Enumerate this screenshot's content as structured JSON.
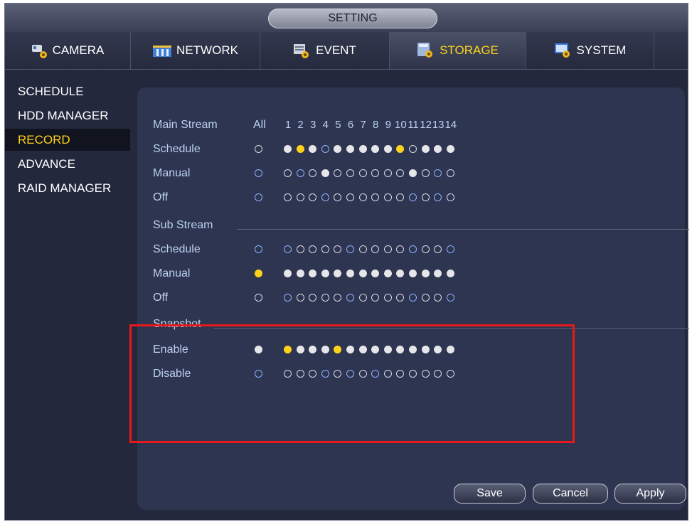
{
  "window": {
    "title": "SETTING"
  },
  "tabs": [
    {
      "label": "CAMERA",
      "icon": "camera-icon",
      "active": false
    },
    {
      "label": "NETWORK",
      "icon": "network-icon",
      "active": false
    },
    {
      "label": "EVENT",
      "icon": "event-icon",
      "active": false
    },
    {
      "label": "STORAGE",
      "icon": "storage-icon",
      "active": true
    },
    {
      "label": "SYSTEM",
      "icon": "system-icon",
      "active": false
    }
  ],
  "sidebar": {
    "items": [
      {
        "label": "SCHEDULE",
        "active": false
      },
      {
        "label": "HDD MANAGER",
        "active": false
      },
      {
        "label": "RECORD",
        "active": true
      },
      {
        "label": "ADVANCE",
        "active": false
      },
      {
        "label": "RAID MANAGER",
        "active": false
      }
    ]
  },
  "record": {
    "main_stream_label": "Main Stream",
    "all_label": "All",
    "channels": [
      "1",
      "2",
      "3",
      "4",
      "5",
      "6",
      "7",
      "8",
      "9",
      "10",
      "11",
      "12",
      "13",
      "14"
    ],
    "sections": [
      {
        "title": "",
        "rows": [
          {
            "label": "Schedule",
            "all": "off",
            "states": [
              "on",
              "sel",
              "on",
              "offb",
              "on",
              "on",
              "on",
              "on",
              "on",
              "sel",
              "off",
              "on",
              "on",
              "on"
            ]
          },
          {
            "label": "Manual",
            "all": "offb",
            "states": [
              "off",
              "offb",
              "off",
              "on",
              "off",
              "off",
              "off",
              "off",
              "off",
              "off",
              "on",
              "off",
              "offb",
              "off"
            ]
          },
          {
            "label": "Off",
            "all": "offb",
            "states": [
              "off",
              "off",
              "off",
              "offb",
              "off",
              "off",
              "off",
              "off",
              "off",
              "off",
              "offb",
              "off",
              "offb",
              "off"
            ]
          }
        ]
      },
      {
        "title": "Sub Stream",
        "rows": [
          {
            "label": "Schedule",
            "all": "offb",
            "states": [
              "offb",
              "off",
              "off",
              "off",
              "off",
              "offb",
              "off",
              "off",
              "off",
              "off",
              "offb",
              "off",
              "off",
              "offb"
            ]
          },
          {
            "label": "Manual",
            "all": "sel",
            "states": [
              "on",
              "on",
              "on",
              "on",
              "on",
              "on",
              "on",
              "on",
              "on",
              "on",
              "on",
              "on",
              "on",
              "on"
            ]
          },
          {
            "label": "Off",
            "all": "off",
            "states": [
              "offb",
              "off",
              "off",
              "off",
              "off",
              "offb",
              "off",
              "off",
              "off",
              "off",
              "offb",
              "off",
              "off",
              "offb"
            ]
          }
        ]
      },
      {
        "title": "Snapshot",
        "rows": [
          {
            "label": "Enable",
            "all": "on",
            "states": [
              "sel",
              "on",
              "on",
              "on",
              "sel",
              "on",
              "on",
              "on",
              "on",
              "on",
              "on",
              "on",
              "on",
              "on"
            ]
          },
          {
            "label": "Disable",
            "all": "offb",
            "states": [
              "off",
              "off",
              "off",
              "offb",
              "off",
              "offb",
              "off",
              "offb",
              "off",
              "off",
              "off",
              "off",
              "off",
              "off"
            ]
          }
        ]
      }
    ]
  },
  "buttons": {
    "save": "Save",
    "cancel": "Cancel",
    "apply": "Apply"
  },
  "colors": {
    "accent": "#ffd21a",
    "highlight": "#e81919",
    "panel": "#2e3550"
  }
}
